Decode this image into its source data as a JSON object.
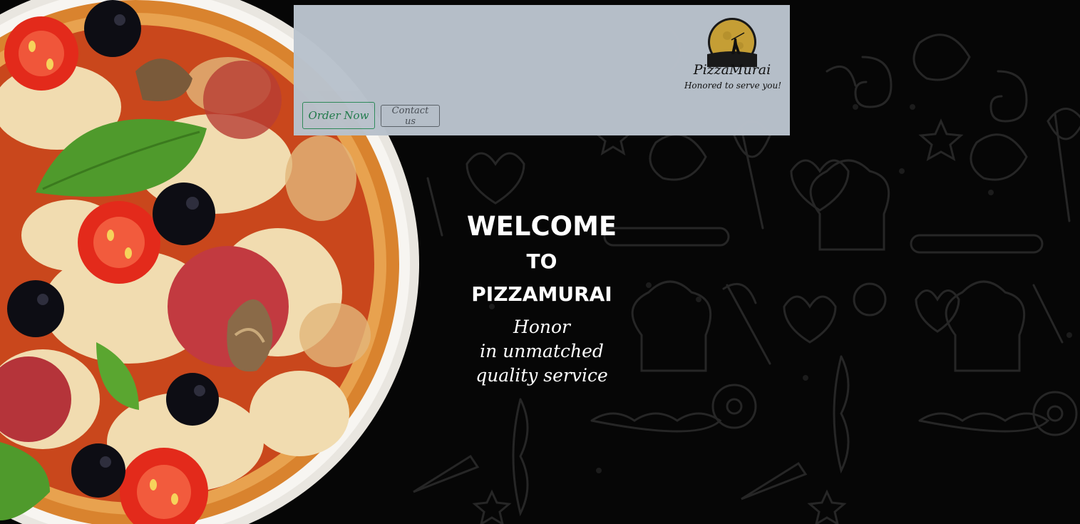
{
  "header": {
    "order_label": "Order Now",
    "contact_label": "Contact us",
    "brand_name": "PizzaMurai",
    "brand_tagline": "Honored to serve you!",
    "logo_icon": "moon-samurai-logo-icon"
  },
  "hero": {
    "line1": "WELCOME",
    "line2": "TO",
    "line3": "PIZZAMURAI",
    "tagline": [
      "Honor",
      "in unmatched",
      "quality service"
    ]
  },
  "colors": {
    "header_bg": "#b9c2cc",
    "order_accent": "#1f7a4c",
    "contact_border": "#5c636a",
    "page_bg": "#060606",
    "doodle_stroke": "#2a2a2a"
  },
  "icons": [
    "pizza-image",
    "baking-doodle-pattern",
    "moon-samurai-logo-icon"
  ]
}
